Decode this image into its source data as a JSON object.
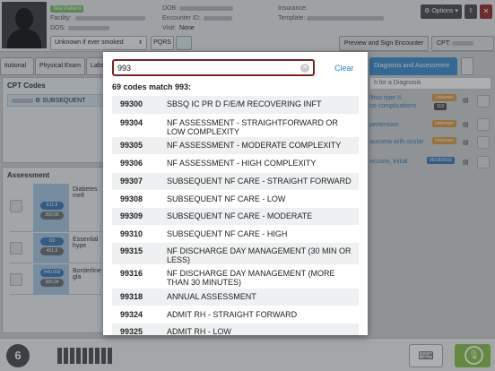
{
  "header": {
    "test_badge": "Test Patient",
    "facility_label": "Facility:",
    "dos_label": "DOS:",
    "dob_label": "DOB:",
    "encounter_label": "Encounter ID:",
    "visit_label": "Visit:",
    "visit_value": "None",
    "insurance_label": "Insurance:",
    "template_label": "Template:",
    "smoking_status": "Unknown if ever smoked",
    "pqrs": "PQRS",
    "options": "Options",
    "preview_sign": "Preview and Sign Encounter",
    "cpt_label": "CPT:"
  },
  "tabs": [
    {
      "label": "itutional"
    },
    {
      "label": "Physical Exam"
    },
    {
      "label": "Labs"
    },
    {
      "label": "Diagnosis and Assessment"
    }
  ],
  "cpt_panel": {
    "title": "CPT Codes",
    "row_text": "SUBSEQUENT"
  },
  "assessment_panel": {
    "title": "Assessment",
    "rows": [
      {
        "label": "Diabetes mell",
        "pill1": "E11.9",
        "pill2": "250.00"
      },
      {
        "label": "Essential hype",
        "pill1": "I10",
        "pill2": "401.9"
      },
      {
        "label": "Borderline gla",
        "pill1": "H40.009",
        "pill2": "365.04"
      }
    ]
  },
  "diagnosis_panel": {
    "search_placeholder": "h for a Diagnosis",
    "rows": [
      {
        "text1": "llitus type II,",
        "text2": "no complications",
        "badge": "Unknown",
        "badge2": "119"
      },
      {
        "text1": "pertension",
        "text2": "",
        "badge": "Unknown",
        "badge2": ""
      },
      {
        "text1": "aucoma with ocular",
        "text2": "",
        "badge": "Unknown",
        "badge2": ""
      },
      {
        "text1": "occoon, initial",
        "text2": "",
        "badge": "05/18/2016",
        "badge2": ""
      }
    ]
  },
  "modal": {
    "search_value": "993",
    "clear_label": "Clear",
    "count_text": "69 codes match 993:",
    "codes": [
      {
        "code": "99300",
        "desc": "SBSQ IC PR D F/E/M RECOVERING INFT"
      },
      {
        "code": "99304",
        "desc": "NF ASSESSMENT - STRAIGHTFORWARD OR LOW COMPLEXITY"
      },
      {
        "code": "99305",
        "desc": "NF ASSESSMENT - MODERATE COMPLEXITY"
      },
      {
        "code": "99306",
        "desc": "NF ASSESSMENT - HIGH COMPLEXITY"
      },
      {
        "code": "99307",
        "desc": "SUBSEQUENT NF CARE - STRAIGHT FORWARD"
      },
      {
        "code": "99308",
        "desc": "SUBSEQUENT NF CARE - LOW"
      },
      {
        "code": "99309",
        "desc": "SUBSEQUENT NF CARE - MODERATE"
      },
      {
        "code": "99310",
        "desc": "SUBSEQUENT NF CARE - HIGH"
      },
      {
        "code": "99315",
        "desc": "NF DISCHARGE DAY MANAGEMENT (30 MIN OR LESS)"
      },
      {
        "code": "99316",
        "desc": "NF DISCHARGE DAY MANAGEMENT (MORE THAN 30 MINUTES)"
      },
      {
        "code": "99318",
        "desc": "ANNUAL ASSESSMENT"
      },
      {
        "code": "99324",
        "desc": "ADMIT RH - STRAIGHT FORWARD"
      },
      {
        "code": "99325",
        "desc": "ADMIT RH - LOW"
      }
    ]
  },
  "icons": [
    "person-avatar-icon",
    "search-clear-icon",
    "keyboard-icon",
    "microphone-icon",
    "app-logo-icon"
  ],
  "colors": {
    "accent": "#3b8fd0",
    "search_border": "#7a2426",
    "mic": "#89c24a",
    "close": "#9b2b2b"
  }
}
